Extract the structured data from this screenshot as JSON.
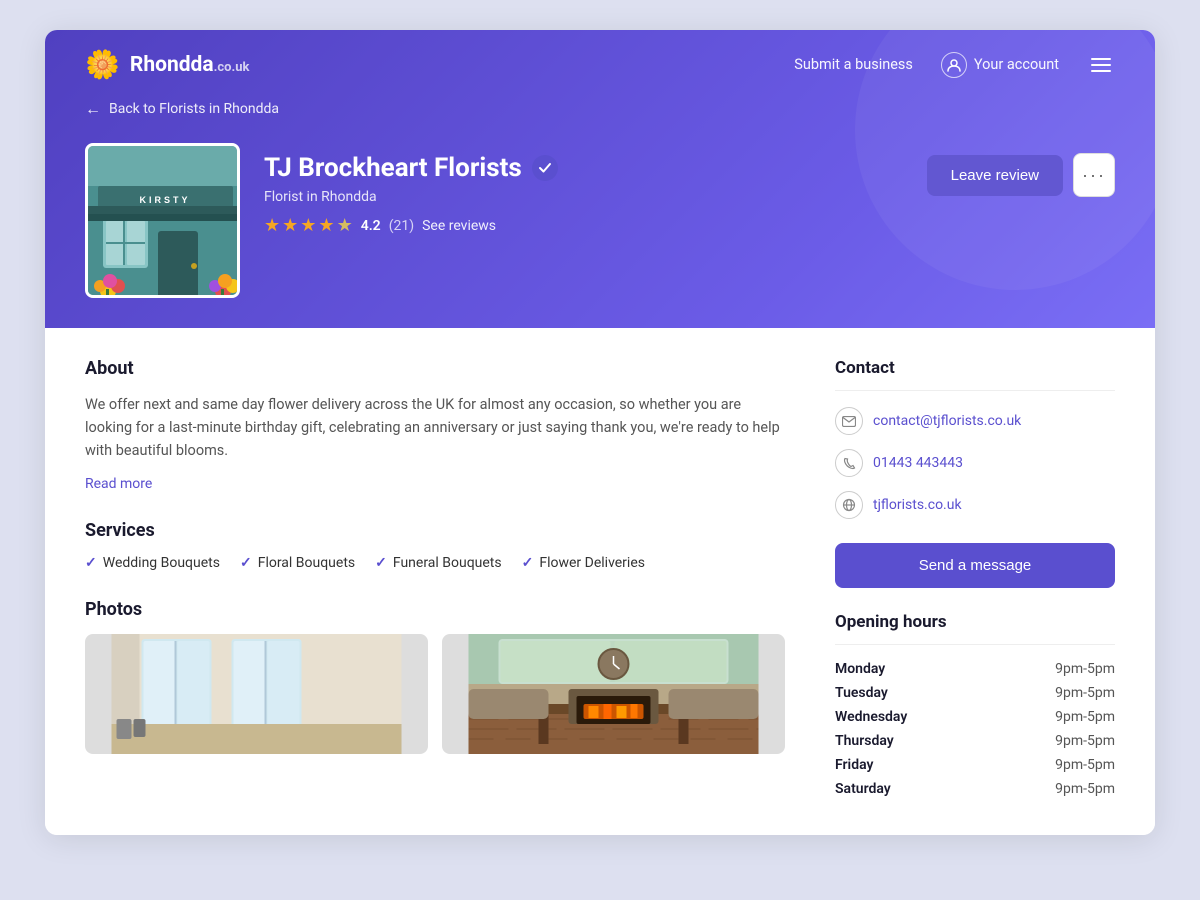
{
  "meta": {
    "bg_color": "#dde0f0",
    "purple": "#5a4fcf"
  },
  "header": {
    "logo_text": "Rhondda",
    "logo_tld": ".co.uk",
    "submit_business": "Submit a business",
    "your_account": "Your account"
  },
  "breadcrumb": {
    "back_text": "Back to Florists in Rhondda"
  },
  "business": {
    "name": "TJ Brockheart Florists",
    "category": "Florist in Rhondda",
    "rating": "4.2",
    "review_count": "(21)",
    "see_reviews": "See reviews",
    "leave_review": "Leave review"
  },
  "about": {
    "title": "About",
    "text": "We offer next and same day flower delivery across the UK for almost any occasion, so whether you are looking for a last-minute birthday gift, celebrating an anniversary or just saying thank you, we're ready to help with beautiful blooms.",
    "read_more": "Read more"
  },
  "services": {
    "title": "Services",
    "items": [
      "Wedding Bouquets",
      "Floral Bouquets",
      "Funeral Bouquets",
      "Flower Deliveries"
    ]
  },
  "photos": {
    "title": "Photos"
  },
  "contact": {
    "title": "Contact",
    "email": "contact@tjflorists.co.uk",
    "phone": "01443 443443",
    "website": "tjflorists.co.uk",
    "send_message": "Send a message"
  },
  "opening_hours": {
    "title": "Opening hours",
    "days": [
      {
        "day": "Monday",
        "hours": "9pm-5pm"
      },
      {
        "day": "Tuesday",
        "hours": "9pm-5pm"
      },
      {
        "day": "Wednesday",
        "hours": "9pm-5pm"
      },
      {
        "day": "Thursday",
        "hours": "9pm-5pm"
      },
      {
        "day": "Friday",
        "hours": "9pm-5pm"
      },
      {
        "day": "Saturday",
        "hours": "9pm-5pm"
      }
    ]
  }
}
